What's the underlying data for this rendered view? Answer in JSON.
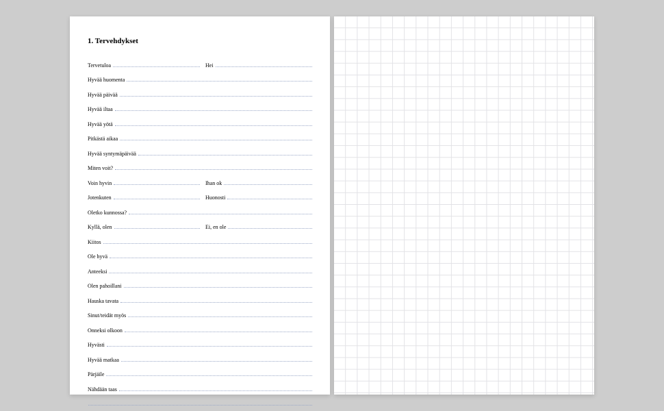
{
  "heading": "1. Tervehdykset",
  "rows": [
    {
      "type": "pair",
      "left": "Tervetuloa",
      "right": "Hei"
    },
    {
      "type": "single",
      "label": "Hyvää huomenta"
    },
    {
      "type": "single",
      "label": "Hyvää päivää"
    },
    {
      "type": "single",
      "label": "Hyvää iltaa"
    },
    {
      "type": "single",
      "label": "Hyvää yötä"
    },
    {
      "type": "single",
      "label": "Pitkästä aikaa"
    },
    {
      "type": "single",
      "label": "Hyvää syntymäpäivää"
    },
    {
      "type": "single",
      "label": "Miten voit?"
    },
    {
      "type": "pair",
      "left": "Voin hyvin",
      "right": "Ihan ok"
    },
    {
      "type": "pair",
      "left": "Jotenkuten",
      "right": "Huonosti"
    },
    {
      "type": "single",
      "label": "Oletko kunnossa?"
    },
    {
      "type": "pair",
      "left": "Kyllä, olen",
      "right": "Ei, en ole"
    },
    {
      "type": "single",
      "label": "Kiitos"
    },
    {
      "type": "single",
      "label": "Ole hyvä"
    },
    {
      "type": "single",
      "label": "Anteeksi"
    },
    {
      "type": "single",
      "label": "Olen pahoillani"
    },
    {
      "type": "single",
      "label": "Hauska tavata"
    },
    {
      "type": "single",
      "label": "Sinut/teidät myös"
    },
    {
      "type": "single",
      "label": "Onneksi olkoon"
    },
    {
      "type": "single",
      "label": "Hyvästi"
    },
    {
      "type": "single",
      "label": "Hyvää matkaa"
    },
    {
      "type": "single",
      "label": "Pärjäile"
    },
    {
      "type": "single",
      "label": "Nähdään taas"
    },
    {
      "type": "blank"
    }
  ]
}
